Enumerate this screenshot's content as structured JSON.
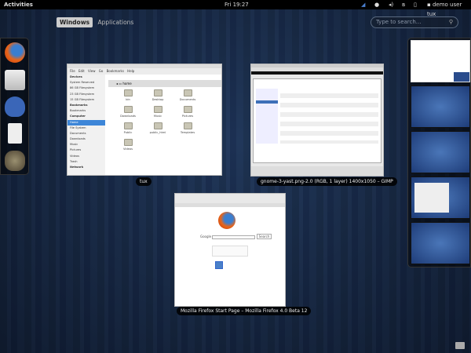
{
  "topbar": {
    "activities": "Activities",
    "clock": "Fri 19:27",
    "user": "demo user tux"
  },
  "overview": {
    "tabs": [
      {
        "label": "Windows",
        "active": true
      },
      {
        "label": "Applications",
        "active": false
      }
    ],
    "search_placeholder": "Type to search..."
  },
  "dash": {
    "items": [
      "firefox-icon",
      "evolution-mail-icon",
      "empathy-icon",
      "document-icon",
      "gimp-icon"
    ]
  },
  "windows": [
    {
      "caption": "tux",
      "app": "nautilus",
      "menu": "File Edit View Go Bookmarks Help",
      "location": "home",
      "sidebar": [
        {
          "label": "Devices",
          "header": true
        },
        {
          "label": "System Reserved"
        },
        {
          "label": "86 GB Filesystem"
        },
        {
          "label": "23 GB Filesystem"
        },
        {
          "label": "15 GB Filesystem"
        },
        {
          "label": "Bookmarks",
          "header": true
        },
        {
          "label": "Bookmarks"
        },
        {
          "label": "Computer",
          "header": true
        },
        {
          "label": "Home",
          "selected": true
        },
        {
          "label": "File System"
        },
        {
          "label": "Documents"
        },
        {
          "label": "Downloads"
        },
        {
          "label": "Music"
        },
        {
          "label": "Pictures"
        },
        {
          "label": "Videos"
        },
        {
          "label": "Trash"
        },
        {
          "label": "Network",
          "header": true
        }
      ],
      "folders": [
        "bin",
        "Desktop",
        "Documents",
        "Downloads",
        "Music",
        "Pictures",
        "Public",
        "public_html",
        "Templates",
        "Videos"
      ]
    },
    {
      "caption": "gnome-3-yast.png-2.0 (RGB, 1 layer) 1400x1050 – GIMP",
      "app": "gimp"
    },
    {
      "caption": "Mozilla Firefox Start Page – Mozilla Firefox 4.0 Beta 12",
      "app": "firefox",
      "search_label": "Google",
      "search_button": "Search"
    }
  ],
  "workspaces": {
    "count": 5,
    "current": 1
  },
  "colors": {
    "accent": "#3d86d8",
    "panel": "#000000"
  }
}
